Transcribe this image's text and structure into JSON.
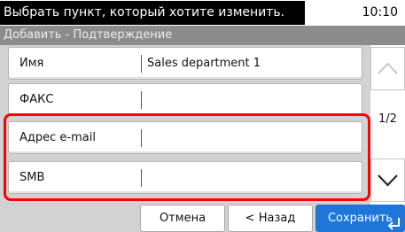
{
  "status_bar": {
    "message": "Выбрать пункт, который хотите изменить.",
    "time": "10:10"
  },
  "screen": {
    "title": "Добавить - Подтверждение"
  },
  "fields": [
    {
      "label": "Имя",
      "value": "Sales department 1"
    },
    {
      "label": "ФАКС",
      "value": ""
    },
    {
      "label": "Адрес e-mail",
      "value": ""
    },
    {
      "label": "SMB",
      "value": ""
    }
  ],
  "scroll": {
    "page": "1/2",
    "up_icon": "chevron-up-icon",
    "down_icon": "chevron-down-icon"
  },
  "buttons": {
    "cancel": "Отмена",
    "back": "< Назад",
    "save": "Сохранить"
  },
  "colors": {
    "accent": "#1e76d8",
    "highlight": "#ff0000",
    "title_bar": "#8c8c8c",
    "background": "#d2d2d2"
  }
}
